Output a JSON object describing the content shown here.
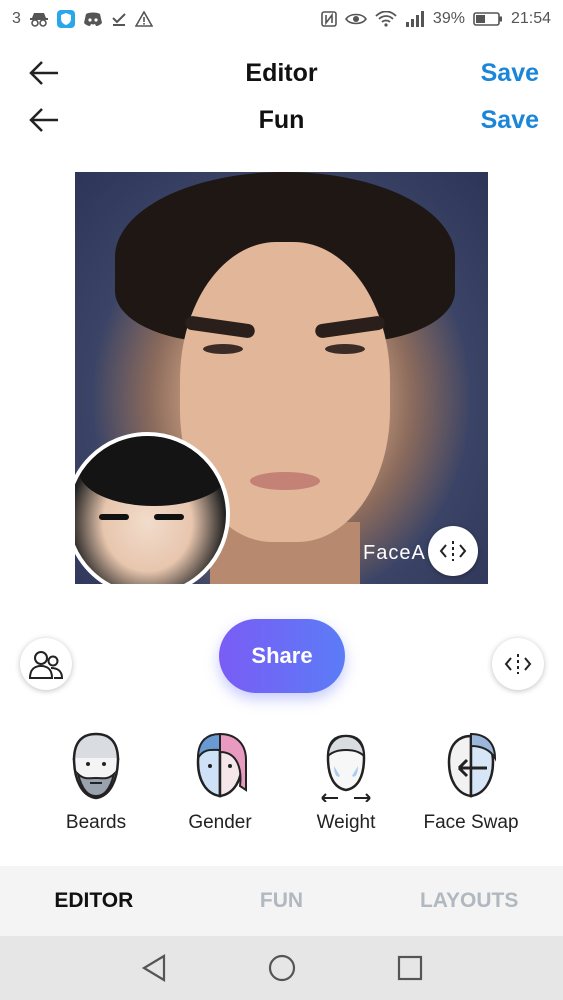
{
  "status_bar": {
    "notification_count": "3",
    "left_icons": [
      "incognito-icon",
      "shield-app-icon",
      "discord-icon",
      "download-done-icon",
      "warning-icon"
    ],
    "right_icons": [
      "nfc-icon",
      "eye-icon",
      "wifi-icon",
      "signal-icon"
    ],
    "battery": "39%",
    "time": "21:54"
  },
  "header": {
    "rows": [
      {
        "title": "Editor",
        "save_label": "Save"
      },
      {
        "title": "Fun",
        "save_label": "Save"
      }
    ]
  },
  "photo": {
    "watermark": "FaceA"
  },
  "actions": {
    "share_label": "Share",
    "share_gradient": [
      "#7a5cf5",
      "#5b7cf6"
    ]
  },
  "tools": [
    {
      "label": "Beards",
      "icon": "beard-face-icon"
    },
    {
      "label": "Gender",
      "icon": "gender-face-icon"
    },
    {
      "label": "Weight",
      "icon": "weight-face-icon"
    },
    {
      "label": "Face Swap",
      "icon": "face-swap-icon"
    }
  ],
  "tabs": [
    {
      "label": "EDITOR",
      "active": true
    },
    {
      "label": "FUN",
      "active": false
    },
    {
      "label": "LAYOUTS",
      "active": false
    }
  ],
  "colors": {
    "accent_blue": "#1a86d9",
    "tab_inactive": "#b2b8bf"
  },
  "nav": {
    "buttons": [
      "back-triangle-icon",
      "home-circle-icon",
      "recents-square-icon"
    ]
  }
}
